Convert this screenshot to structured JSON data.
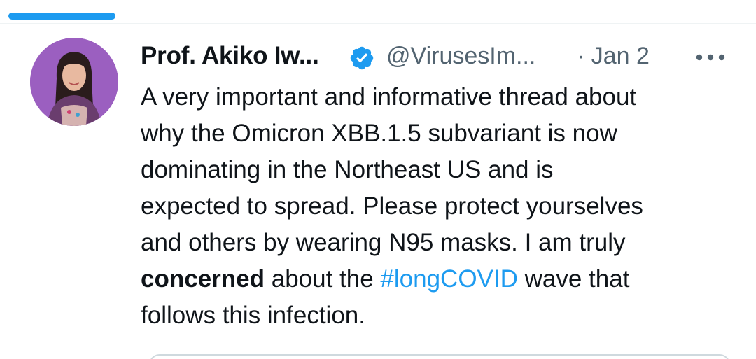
{
  "tweet": {
    "author_name": "Prof. Akiko Iw...",
    "handle": "@VirusesIm...",
    "date": "· Jan 2",
    "text_lines": [
      "A very important and informative thread about",
      "why the Omicron XBB.1.5 subvariant is now",
      "dominating in the Northeast US and is",
      "expected to spread. Please protect yourselves",
      "and others by wearing N95 masks. I am truly"
    ],
    "line6_bold": "concerned",
    "line6_middle": " about the ",
    "hashtag": "#longCOVID",
    "line6_end": " wave that",
    "line7": "follows this infection."
  },
  "icons": {
    "verified": "verified-badge-icon",
    "more": "more-options-icon"
  },
  "colors": {
    "accent": "#1d9bf0",
    "secondary_text": "#536471",
    "primary_text": "#0f1419",
    "avatar_bg": "#9b5fc0"
  }
}
